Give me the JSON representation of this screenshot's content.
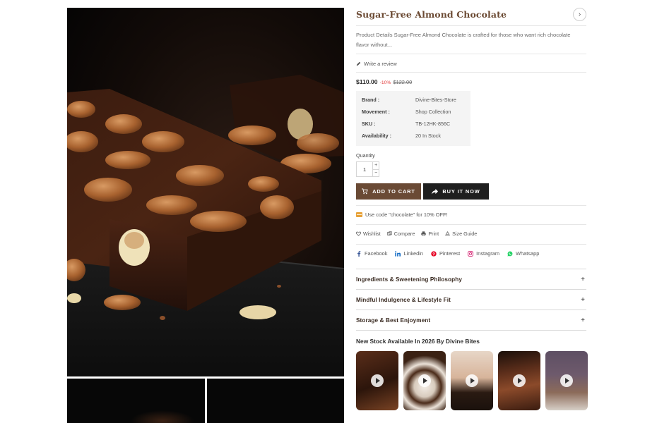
{
  "product": {
    "title": "Sugar-Free Almond Chocolate",
    "description": "Product Details Sugar-Free Almond Chocolate is crafted for those who want rich chocolate flavor without...",
    "review_link": "Write a review",
    "price": "$110.00",
    "discount": "-10%",
    "old_price": "$122.00",
    "specs": [
      {
        "key": "Brand :",
        "value": "Divine-Bites-Store"
      },
      {
        "key": "Movement :",
        "value": "Shop Collection"
      },
      {
        "key": "SKU :",
        "value": "TB-12HK-856C"
      },
      {
        "key": "Availability :",
        "value": "20 In Stock"
      }
    ],
    "quantity_label": "Quantity",
    "quantity_value": "1",
    "qty_plus": "+",
    "qty_minus": "−"
  },
  "buttons": {
    "add_to_cart": "ADD TO CART",
    "buy_now": "BUY IT NOW"
  },
  "coupon": "Use code \"chocolate\" for 10% OFF!",
  "actions": [
    "Wishlist",
    "Compare",
    "Print",
    "Size Guide"
  ],
  "social": [
    {
      "label": "Facebook",
      "icon": "facebook-icon",
      "color": "#3b5998"
    },
    {
      "label": "Linkedin",
      "icon": "linkedin-icon",
      "color": "#0a66c2"
    },
    {
      "label": "Pinterest",
      "icon": "pinterest-icon",
      "color": "#e60023"
    },
    {
      "label": "Instagram",
      "icon": "instagram-icon",
      "color": "#d62976"
    },
    {
      "label": "Whatsapp",
      "icon": "whatsapp-icon",
      "color": "#25d366"
    }
  ],
  "accordion": [
    {
      "label": "Ingredients & Sweetening Philosophy",
      "toggle": "+"
    },
    {
      "label": "Mindful Indulgence & Lifestyle Fit",
      "toggle": "+"
    },
    {
      "label": "Storage & Best Enjoyment",
      "toggle": "+"
    }
  ],
  "stock_title": "New Stock Available In 2026 By Divine Bites",
  "share_icon": "›",
  "colors": {
    "title_brown": "#6b4a33",
    "cart_button": "#6a4a35",
    "buy_button": "#1f1f1f",
    "discount_red": "#e23b3b"
  }
}
